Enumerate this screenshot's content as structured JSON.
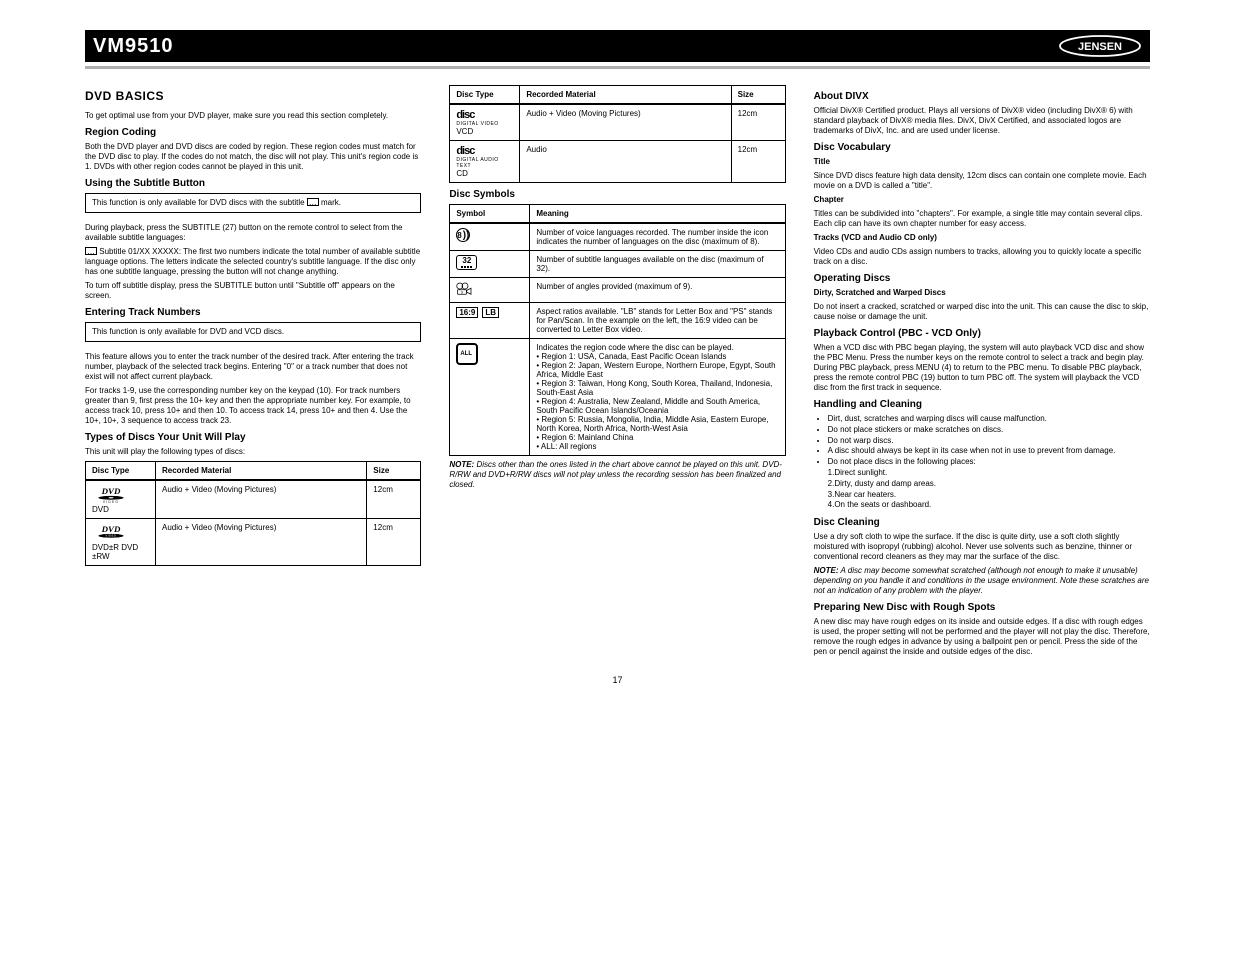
{
  "topbar": {
    "model": "VM9510"
  },
  "page_number": "17",
  "col1": {
    "h1": "DVD BASICS",
    "p1": "To get optimal use from your DVD player, make sure you read this section completely.",
    "h2a": "Region Coding",
    "p2": "Both the DVD player and DVD discs are coded by region. These region codes must match for the DVD disc to play. If the codes do not match, the disc will not play. This unit's region code is 1. DVDs with other region codes cannot be played in this unit.",
    "h2b": "Using the Subtitle Button",
    "notice1": "This function is only available for DVD discs with the subtitle ",
    "notice1_suffix": " mark.",
    "p3a": "During playback, press the SUBTITLE (27) button on the remote control to select from the available subtitle languages:",
    "p3b": " Subtitle 01/XX XXXXX: The first two numbers indicate the total number of available subtitle language options. The letters indicate the selected country's subtitle language. If the disc only has one subtitle language, pressing the button will not change anything.",
    "p3c": "To turn off subtitle display, press the SUBTITLE button until \"Subtitle off\" appears on the screen.",
    "h2c": "Entering Track Numbers",
    "notice2": "This function is only available for DVD and VCD discs.",
    "p4a": "This feature allows you to enter the track number of the desired track. After entering the track number, playback of the selected track begins. Entering \"0\" or a track number that does not exist will not affect current playback.",
    "p4b": "For tracks 1-9, use the corresponding number key on the keypad (10). For track numbers greater than 9, first press the 10+ key and then the appropriate number key. For example, to access track 10, press 10+ and then 10. To access track 14, press 10+ and then 4. Use the 10+, 10+, 3 sequence to access track 23.",
    "h2d": "Types of Discs Your Unit Will Play",
    "p5": "This unit will play the following types of discs:",
    "table1": {
      "head": [
        "Disc Type",
        "Recorded Material",
        "Size"
      ],
      "rows": [
        {
          "icon": "dvd",
          "label": "DVD",
          "mat": "Audio + Video (Moving Pictures)",
          "size": "12cm"
        },
        {
          "icon": "dvd2",
          "label": "DVD±R DVD ±RW",
          "mat": "Audio + Video (Moving Pictures)",
          "size": "12cm"
        }
      ]
    }
  },
  "col2": {
    "table1cont": {
      "head": [
        "Disc Type",
        "Recorded Material",
        "Size"
      ],
      "rows": [
        {
          "icon": "vcd",
          "sublines": [
            "DIGITAL VIDEO"
          ],
          "label": "VCD",
          "mat": "Audio + Video (Moving Pictures)",
          "size": "12cm"
        },
        {
          "icon": "cd",
          "sublines": [
            "DIGITAL AUDIO",
            "TEXT"
          ],
          "label": "CD",
          "mat": "Audio",
          "size": "12cm"
        }
      ]
    },
    "h2a": "Disc Symbols",
    "table2": {
      "head": [
        "Symbol",
        "Meaning"
      ],
      "rows": [
        {
          "sym": "audio8",
          "text": "Number of voice languages recorded. The number inside the icon indicates the number of languages on the disc (maximum of 8)."
        },
        {
          "sym": "sub32",
          "text": "Number of subtitle languages available on the disc (maximum of 32)."
        },
        {
          "sym": "angle",
          "text": "Number of angles provided (maximum of 9)."
        },
        {
          "sym": "ratio",
          "text": "Aspect ratios available. \"LB\" stands for Letter Box and \"PS\" stands for Pan/Scan. In the example on the left, the 16:9 video can be converted to Letter Box video."
        },
        {
          "sym": "region",
          "text": "Indicates the region code where the disc can be played.\n• Region 1: USA, Canada, East Pacific Ocean Islands\n• Region 2: Japan, Western Europe, Northern Europe, Egypt, South Africa, Middle East\n• Region 3: Taiwan, Hong Kong, South Korea, Thailand, Indonesia, South-East Asia\n• Region 4: Australia, New Zealand, Middle and South America, South Pacific Ocean Islands/Oceania\n• Region 5: Russia, Mongolia, India, Middle Asia, Eastern Europe, North Korea, North Africa, North-West Asia\n• Region 6: Mainland China\n• ALL: All regions"
        }
      ]
    },
    "h2b_note": "NOTE:",
    "p_note": "Discs other than the ones listed in the chart above cannot be played on this unit. DVD-R/RW and DVD+R/RW discs will not play unless the recording session has been finalized and closed."
  },
  "col3": {
    "h2a": "About DIVX",
    "p1": "Official DivX® Certified product. Plays all versions of DivX® video (including DivX® 6) with standard playback of DivX® media files. DivX, DivX Certified, and associated logos are trademarks of DivX, Inc. and are used under license.",
    "h2b": "Disc Vocabulary",
    "t_title_h": "Title",
    "t_title_p": "Since DVD discs feature high data density, 12cm discs can contain one complete movie. Each movie on a DVD is called a \"title\".",
    "t_chapter_h": "Chapter",
    "t_chapter_p": "Titles can be subdivided into \"chapters\". For example, a single title may contain several clips. Each clip can have its own chapter number for easy access.",
    "t_tracks_h": "Tracks (VCD and Audio CD only)",
    "t_tracks_p": "Video CDs and audio CDs assign numbers to tracks, allowing you to quickly locate a specific track on a disc.",
    "h2c": "Operating Discs",
    "t_dirty_h": "Dirty, Scratched and Warped Discs",
    "t_dirty_p": "Do not insert a cracked, scratched or warped disc into the unit. This can cause the disc to skip, cause noise or damage the unit.",
    "h2d": "Playback Control (PBC - VCD Only)",
    "p2": "When a VCD disc with PBC began playing, the system will auto playback VCD disc and show the PBC Menu. Press the number keys on the remote control to select a track and begin play. During PBC playback, press MENU (4) to return to the PBC menu. To disable PBC playback, press the remote control PBC (19) button to turn PBC off. The system will playback the VCD disc from the first track in sequence.",
    "h2e": "Handling and Cleaning",
    "bullets": [
      "Dirt, dust, scratches and warping discs will cause malfunction.",
      "Do not place stickers or make scratches on discs.",
      "Do not warp discs.",
      "A disc should always be kept in its case when not in use to prevent from damage.",
      "Do not place discs in the following places:\n1.Direct sunlight.\n2.Dirty, dusty and damp areas.\n3.Near car heaters.\n4.On the seats or dashboard."
    ],
    "h2f": "Disc Cleaning",
    "p3": "Use a dry soft cloth to wipe the surface. If the disc is quite dirty, use a soft cloth slightly moistured with isopropyl (rubbing) alcohol. Never use solvents such as benzine, thinner or conventional record cleaners as they may mar the surface of the disc.",
    "h2g_note": "NOTE:",
    "p4": "A disc may become somewhat scratched (although not enough to make it unusable) depending on you handle it and conditions in the usage environment. Note these scratches are not an indication of any problem with the player.",
    "h2h": "Preparing New Disc with Rough Spots",
    "p5": "A new disc may have rough edges on its inside and outside edges. If a disc with rough edges is used, the proper setting will not be performed and the player will not play the disc. Therefore, remove the rough edges in advance by using a ballpoint pen or pencil. Press the side of the pen or pencil against the inside and outside edges of the disc."
  }
}
